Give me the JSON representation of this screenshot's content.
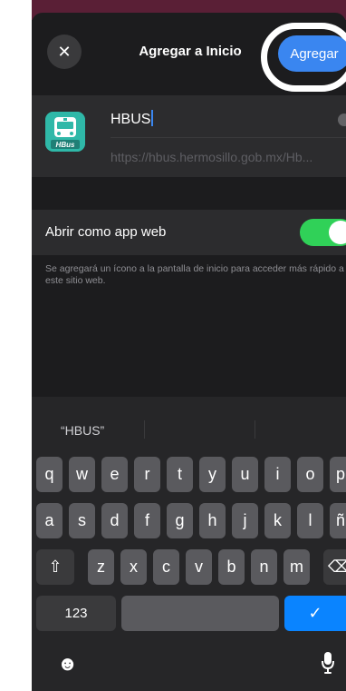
{
  "nav": {
    "close_symbol": "✕",
    "title": "Agregar a Inicio",
    "add_label": "Agregar"
  },
  "app": {
    "name": "HBUS",
    "url": "https://hbus.hermosillo.gob.mx/Hb...",
    "icon_text": "HBus"
  },
  "web_app": {
    "label": "Abrir como app web",
    "enabled": true,
    "note": "Se agregará un ícono a la pantalla de inicio para acceder más rápido a este sitio web."
  },
  "keyboard": {
    "suggestion": "“HBUS”",
    "row1": [
      "q",
      "w",
      "e",
      "r",
      "t",
      "y",
      "u",
      "i",
      "o",
      "p"
    ],
    "row2": [
      "a",
      "s",
      "d",
      "f",
      "g",
      "h",
      "j",
      "k",
      "l",
      "ñ"
    ],
    "row3": [
      "z",
      "x",
      "c",
      "v",
      "b",
      "n",
      "m"
    ],
    "shift_symbol": "⇧",
    "delete_symbol": "⌫",
    "numbers_label": "123",
    "return_symbol": "✓",
    "emoji_symbol": "☻"
  },
  "colors": {
    "accent": "#3a86f0",
    "toggle_on": "#30d158",
    "return_key": "#0a84ff"
  }
}
